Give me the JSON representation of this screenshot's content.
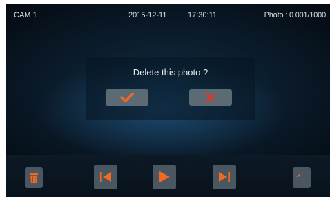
{
  "status_bar": {
    "camera": "CAM 1",
    "date": "2015-12-11",
    "time": "17:30:11",
    "photo_counter": "Photo : 0 001/1000"
  },
  "dialog": {
    "message": "Delete this photo ?",
    "confirm_icon": "checkmark-icon",
    "cancel_icon": "x-icon"
  },
  "toolbar": {
    "buttons": [
      {
        "name": "delete",
        "icon": "trash-icon"
      },
      {
        "name": "previous",
        "icon": "skip-previous-icon"
      },
      {
        "name": "play",
        "icon": "play-icon"
      },
      {
        "name": "next",
        "icon": "skip-next-icon"
      },
      {
        "name": "back",
        "icon": "return-arrow-icon"
      }
    ]
  },
  "colors": {
    "accent_orange": "#f26a21",
    "cancel_red": "#e0372b",
    "button_gray": "#5c6a74",
    "toolbar_button_gray": "#4a5660",
    "text": "#d7dde2"
  }
}
